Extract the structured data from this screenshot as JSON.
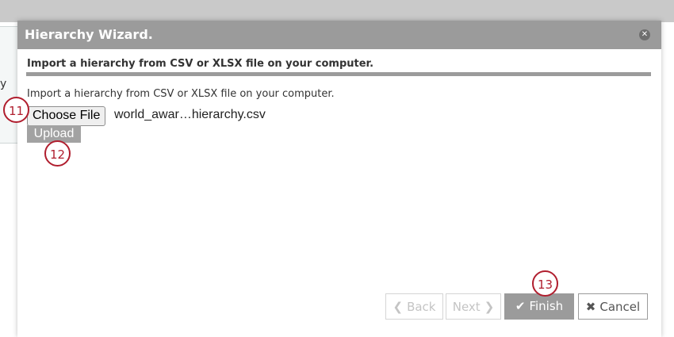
{
  "background": {
    "partial_text": "y"
  },
  "dialog": {
    "title": "Hierarchy Wizard.",
    "close_icon": "close-circle-icon",
    "section_heading": "Import a hierarchy from CSV or XLSX file on your computer.",
    "instructions": "Import a hierarchy from CSV or XLSX file on your computer.",
    "choose_file_label": "Choose File",
    "file_name": "world_awar…hierarchy.csv",
    "upload_label": "Upload"
  },
  "footer": {
    "back_label": "Back",
    "back_icon": "chevron-left-icon",
    "next_label": "Next",
    "next_icon": "chevron-right-icon",
    "finish_label": "Finish",
    "finish_icon": "check-icon",
    "cancel_label": "Cancel",
    "cancel_icon": "x-icon"
  },
  "callouts": {
    "c11": "11",
    "c12": "12",
    "c13": "13"
  },
  "colors": {
    "header": "#9b9b9b",
    "callout": "#b01e2e"
  }
}
